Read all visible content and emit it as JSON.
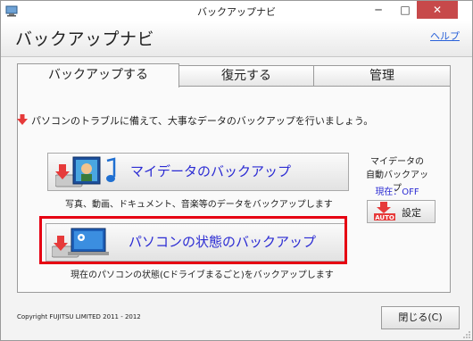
{
  "window": {
    "title": "バックアップナビ",
    "minimize_glyph": "─",
    "maximize_glyph": "□",
    "close_glyph": "✕"
  },
  "header": {
    "app_title": "バックアップナビ",
    "help_link": "ヘルプ"
  },
  "tabs": [
    {
      "label": "バックアップする",
      "active": true
    },
    {
      "label": "復元する",
      "active": false
    },
    {
      "label": "管理",
      "active": false
    }
  ],
  "main": {
    "intro_text": "パソコンのトラブルに備えて、大事なデータのバックアップを行いましょう。",
    "mydata_button_label": "マイデータのバックアップ",
    "mydata_description": "写真、動画、ドキュメント、音楽等のデータをバックアップします",
    "pcstate_button_label": "パソコンの状態のバックアップ",
    "pcstate_description": "現在のパソコンの状態(Cドライブまるごと)をバックアップします"
  },
  "auto_backup": {
    "title_line1": "マイデータの",
    "title_line2": "自動バックアップ",
    "status": "現在：OFF",
    "settings_button": "設定",
    "auto_badge": "AUTO"
  },
  "footer": {
    "copyright": "Copyright FUJITSU LIMITED 2011 - 2012",
    "close_button": "閉じる(C)"
  },
  "colors": {
    "accent_blue": "#2b2bd3",
    "highlight_red": "#e60012",
    "close_red": "#c7494a"
  },
  "icons": [
    "app-icon",
    "red-down-arrow-icon",
    "photo-music-icon",
    "pc-gear-icon",
    "auto-badge-icon",
    "resize-grip-icon"
  ]
}
